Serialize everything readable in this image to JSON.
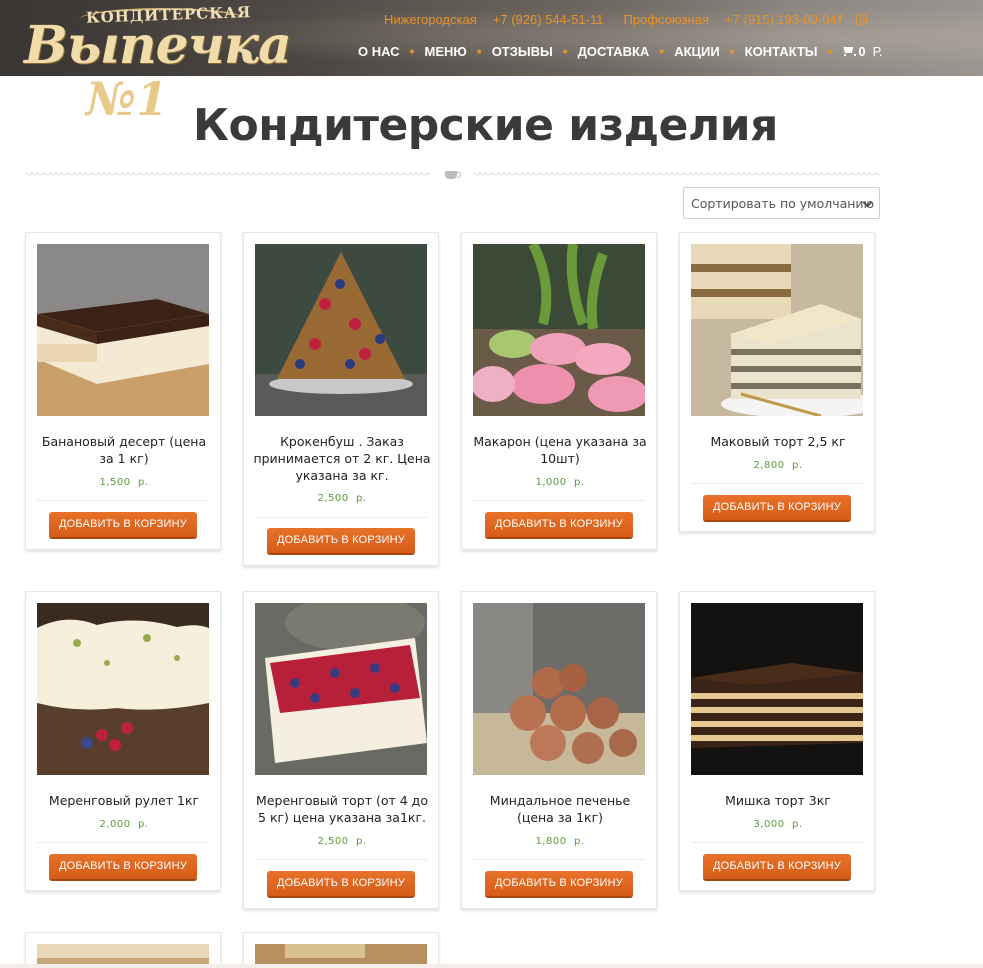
{
  "header": {
    "logo_top": "КОНДИТЕРСКАЯ",
    "logo_main": "Выпечка",
    "logo_number": "№1",
    "contacts": [
      {
        "station": "Нижегородская",
        "phone": "+7 (926) 544-51-11"
      },
      {
        "station": "Профсоюзная",
        "phone": "+7 (915) 193-00-04"
      }
    ],
    "social": {
      "facebook": "f",
      "instagram": "instagram-icon"
    },
    "nav": [
      "О НАС",
      "МЕНЮ",
      "ОТЗЫВЫ",
      "ДОСТАВКА",
      "АКЦИИ",
      "КОНТАКТЫ"
    ],
    "cart": {
      "count": "0",
      "currency": "Р."
    }
  },
  "page": {
    "title": "Кондитерские изделия",
    "sort_label": "Сортировать по умолчанию"
  },
  "products": [
    {
      "name": "Банановый десерт (цена за 1 кг)",
      "price": "1,500",
      "currency": "р.",
      "button": "ДОБАВИТЬ В КОРЗИНУ"
    },
    {
      "name": "Крокенбуш . Заказ принимается от 2 кг. Цена указана за кг.",
      "price": "2,500",
      "currency": "р.",
      "button": "ДОБАВИТЬ В КОРЗИНУ"
    },
    {
      "name": "Макарон (цена указана за 10шт)",
      "price": "1,000",
      "currency": "р.",
      "button": "ДОБАВИТЬ В КОРЗИНУ"
    },
    {
      "name": "Маковый торт 2,5 кг",
      "price": "2,800",
      "currency": "р.",
      "button": "ДОБАВИТЬ В КОРЗИНУ"
    },
    {
      "name": "Меренговый рулет 1кг",
      "price": "2,000",
      "currency": "р.",
      "button": "ДОБАВИТЬ В КОРЗИНУ"
    },
    {
      "name": "Меренговый торт (от 4 до 5 кг) цена указана за1кг.",
      "price": "2,500",
      "currency": "р.",
      "button": "ДОБАВИТЬ В КОРЗИНУ"
    },
    {
      "name": "Миндальное печенье (цена за 1кг)",
      "price": "1,800",
      "currency": "р.",
      "button": "ДОБАВИТЬ В КОРЗИНУ"
    },
    {
      "name": "Мишка торт 3кг",
      "price": "3,000",
      "currency": "р.",
      "button": "ДОБАВИТЬ В КОРЗИНУ"
    }
  ],
  "colors": {
    "accent": "#e8932a",
    "button": "#e2682a",
    "price": "#5a9b3a",
    "title": "#3a3a3a"
  }
}
